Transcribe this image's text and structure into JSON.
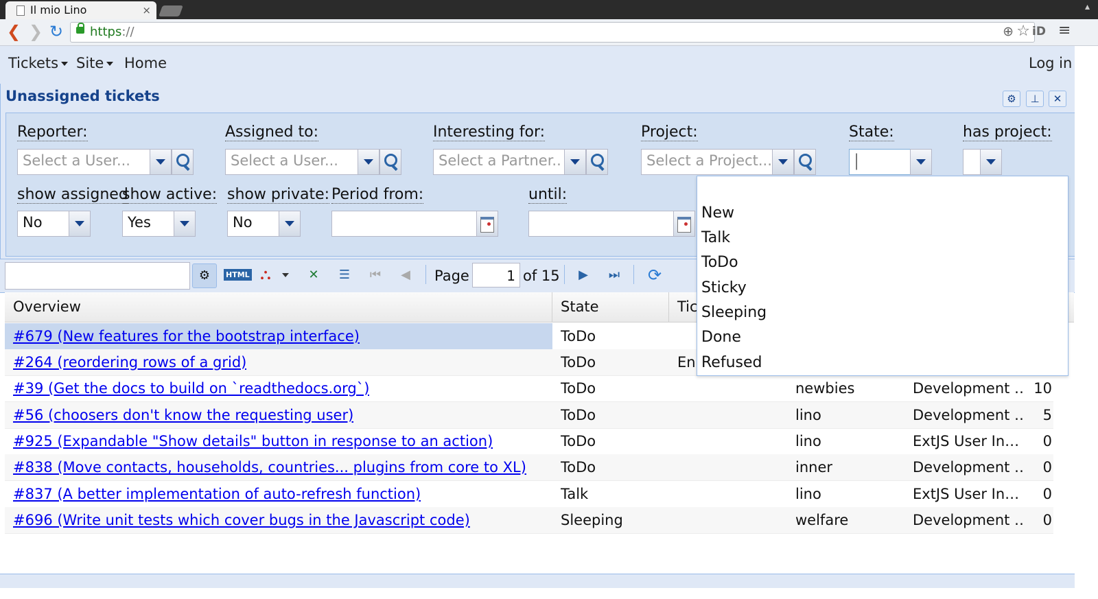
{
  "browser": {
    "tab_title": "Il mio Lino",
    "tab_close": "×",
    "url_scheme": "https",
    "url_rest": "://"
  },
  "app": {
    "menus": [
      {
        "label": "Tickets"
      },
      {
        "label": "Site"
      },
      {
        "label": "Home"
      }
    ],
    "login_label": "Log in"
  },
  "panel": {
    "title": "Unassigned tickets",
    "filters": {
      "reporter": {
        "label": "Reporter:",
        "placeholder": "Select a User..."
      },
      "assigned_to": {
        "label": "Assigned to:",
        "placeholder": "Select a User..."
      },
      "interesting_for": {
        "label": "Interesting for:",
        "placeholder": "Select a Partner.."
      },
      "project": {
        "label": "Project:",
        "placeholder": "Select a Project..."
      },
      "state": {
        "label": "State:",
        "value": ""
      },
      "has_project": {
        "label": "has project:",
        "value": ""
      },
      "show_assigned": {
        "label": "show assigned",
        "value": "No"
      },
      "show_active": {
        "label": "show active:",
        "value": "Yes"
      },
      "show_private": {
        "label": "show private:",
        "value": "No"
      },
      "period_from": {
        "label": "Period from:",
        "value": ""
      },
      "until": {
        "label": "until:",
        "value": ""
      }
    }
  },
  "pager": {
    "page_label": "Page",
    "page_value": "1",
    "of_label": "of 15"
  },
  "grid": {
    "columns": [
      "Overview",
      "State",
      "Tick"
    ],
    "rows": [
      {
        "overview": "#679 (New features for the bootstrap interface)",
        "state": "ToDo",
        "ticket": "",
        "project": "",
        "site": "",
        "num": ""
      },
      {
        "overview": "#264 (reordering rows of a grid)",
        "state": "ToDo",
        "ticket": "En",
        "project": "",
        "site": "",
        "num": ""
      },
      {
        "overview": "#39 (Get the docs to build on `readthedocs.org`)",
        "state": "ToDo",
        "ticket": "",
        "project": "newbies",
        "site": "Development …",
        "num": "10"
      },
      {
        "overview": "#56 (choosers don't know the requesting user)",
        "state": "ToDo",
        "ticket": "",
        "project": "lino",
        "site": "Development …",
        "num": "5"
      },
      {
        "overview": "#925 (Expandable \"Show details\" button in response to an action)",
        "state": "ToDo",
        "ticket": "",
        "project": "lino",
        "site": "ExtJS User In…",
        "num": "0"
      },
      {
        "overview": "#838 (Move contacts, households, countries... plugins from core to XL)",
        "state": "ToDo",
        "ticket": "",
        "project": "inner",
        "site": "Development …",
        "num": "0"
      },
      {
        "overview": "#837 (A better implementation of auto-refresh function)",
        "state": "Talk",
        "ticket": "",
        "project": "lino",
        "site": "ExtJS User In…",
        "num": "0"
      },
      {
        "overview": "#696 (Write unit tests which cover bugs in the Javascript code)",
        "state": "Sleeping",
        "ticket": "",
        "project": "welfare",
        "site": "Development …",
        "num": "0"
      }
    ]
  },
  "state_dropdown": {
    "options": [
      "",
      "New",
      "Talk",
      "ToDo",
      "Sticky",
      "Sleeping",
      "Done",
      "Refused"
    ]
  },
  "colors": {
    "panel_bg": "#dfe8f6",
    "border": "#99bbe8",
    "title": "#15428b",
    "link": "#0000ee"
  }
}
